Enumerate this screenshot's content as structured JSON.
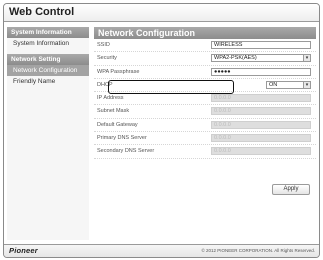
{
  "window": {
    "title": "Web Control"
  },
  "sidebar": {
    "sections": [
      {
        "heading": "System Information",
        "items": [
          {
            "label": "System Information",
            "active": false
          }
        ]
      },
      {
        "heading": "Network Setting",
        "items": [
          {
            "label": "Network Configuration",
            "active": true
          },
          {
            "label": "Friendly Name",
            "active": false
          }
        ]
      }
    ]
  },
  "main": {
    "heading": "Network Configuration",
    "fields": {
      "ssid": {
        "label": "SSID",
        "value": "WIRELESS"
      },
      "security": {
        "label": "Security",
        "value": "WPA2-PSK(AES)"
      },
      "wpa_passphrase": {
        "label": "WPA Passphrase",
        "value": "●●●●●"
      },
      "dhcp": {
        "label": "DHCP",
        "value": "ON"
      },
      "ip_address": {
        "label": "IP Address",
        "value": "0.0.0.0"
      },
      "subnet_mask": {
        "label": "Subnet Mask",
        "value": "0.0.0.0"
      },
      "default_gateway": {
        "label": "Default Gateway",
        "value": "0.0.0.0"
      },
      "primary_dns": {
        "label": "Primary DNS Server",
        "value": "0.0.0.0"
      },
      "secondary_dns": {
        "label": "Secondary DNS Server",
        "value": "0.0.0.0"
      }
    },
    "apply_label": "Apply"
  },
  "footer": {
    "logo": "Pioneer",
    "copyright": "© 2012 PIONEER CORPORATION. All Rights Reserved."
  },
  "colors": {
    "header_gray": "#999999",
    "active_item": "#a3a3a3",
    "disabled_field": "#dedede"
  }
}
